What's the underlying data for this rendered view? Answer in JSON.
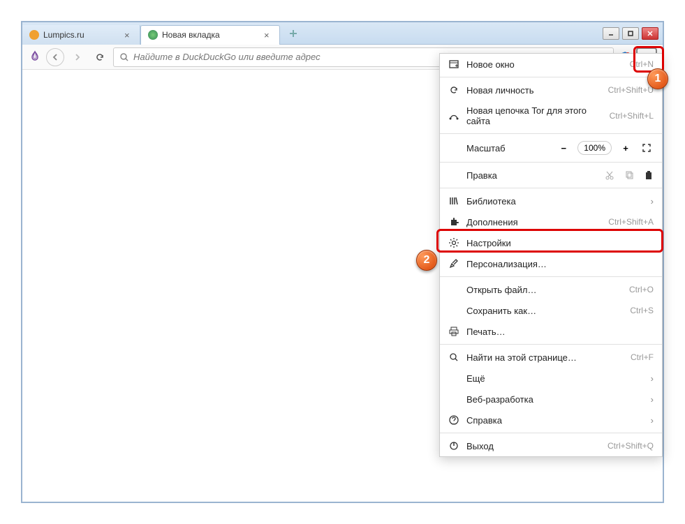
{
  "tabs": [
    {
      "title": "Lumpics.ru",
      "favicon_color": "#f0a030"
    },
    {
      "title": "Новая вкладка",
      "favicon_color": "#4a8"
    }
  ],
  "urlbar": {
    "placeholder": "Найдите в DuckDuckGo или введите адрес"
  },
  "menu": {
    "new_window": {
      "label": "Новое окно",
      "shortcut": "Ctrl+N"
    },
    "new_identity": {
      "label": "Новая личность",
      "shortcut": "Ctrl+Shift+U"
    },
    "new_circuit": {
      "label": "Новая цепочка Tor для этого сайта",
      "shortcut": "Ctrl+Shift+L"
    },
    "zoom": {
      "label": "Масштаб",
      "value": "100%"
    },
    "edit": {
      "label": "Правка"
    },
    "library": {
      "label": "Библиотека"
    },
    "addons": {
      "label": "Дополнения",
      "shortcut": "Ctrl+Shift+A"
    },
    "settings": {
      "label": "Настройки"
    },
    "customize": {
      "label": "Персонализация…"
    },
    "open_file": {
      "label": "Открыть файл…",
      "shortcut": "Ctrl+O"
    },
    "save_as": {
      "label": "Сохранить как…",
      "shortcut": "Ctrl+S"
    },
    "print": {
      "label": "Печать…"
    },
    "find": {
      "label": "Найти на этой странице…",
      "shortcut": "Ctrl+F"
    },
    "more": {
      "label": "Ещё"
    },
    "webdev": {
      "label": "Веб-разработка"
    },
    "help": {
      "label": "Справка"
    },
    "exit": {
      "label": "Выход",
      "shortcut": "Ctrl+Shift+Q"
    }
  },
  "callouts": {
    "one": "1",
    "two": "2"
  }
}
